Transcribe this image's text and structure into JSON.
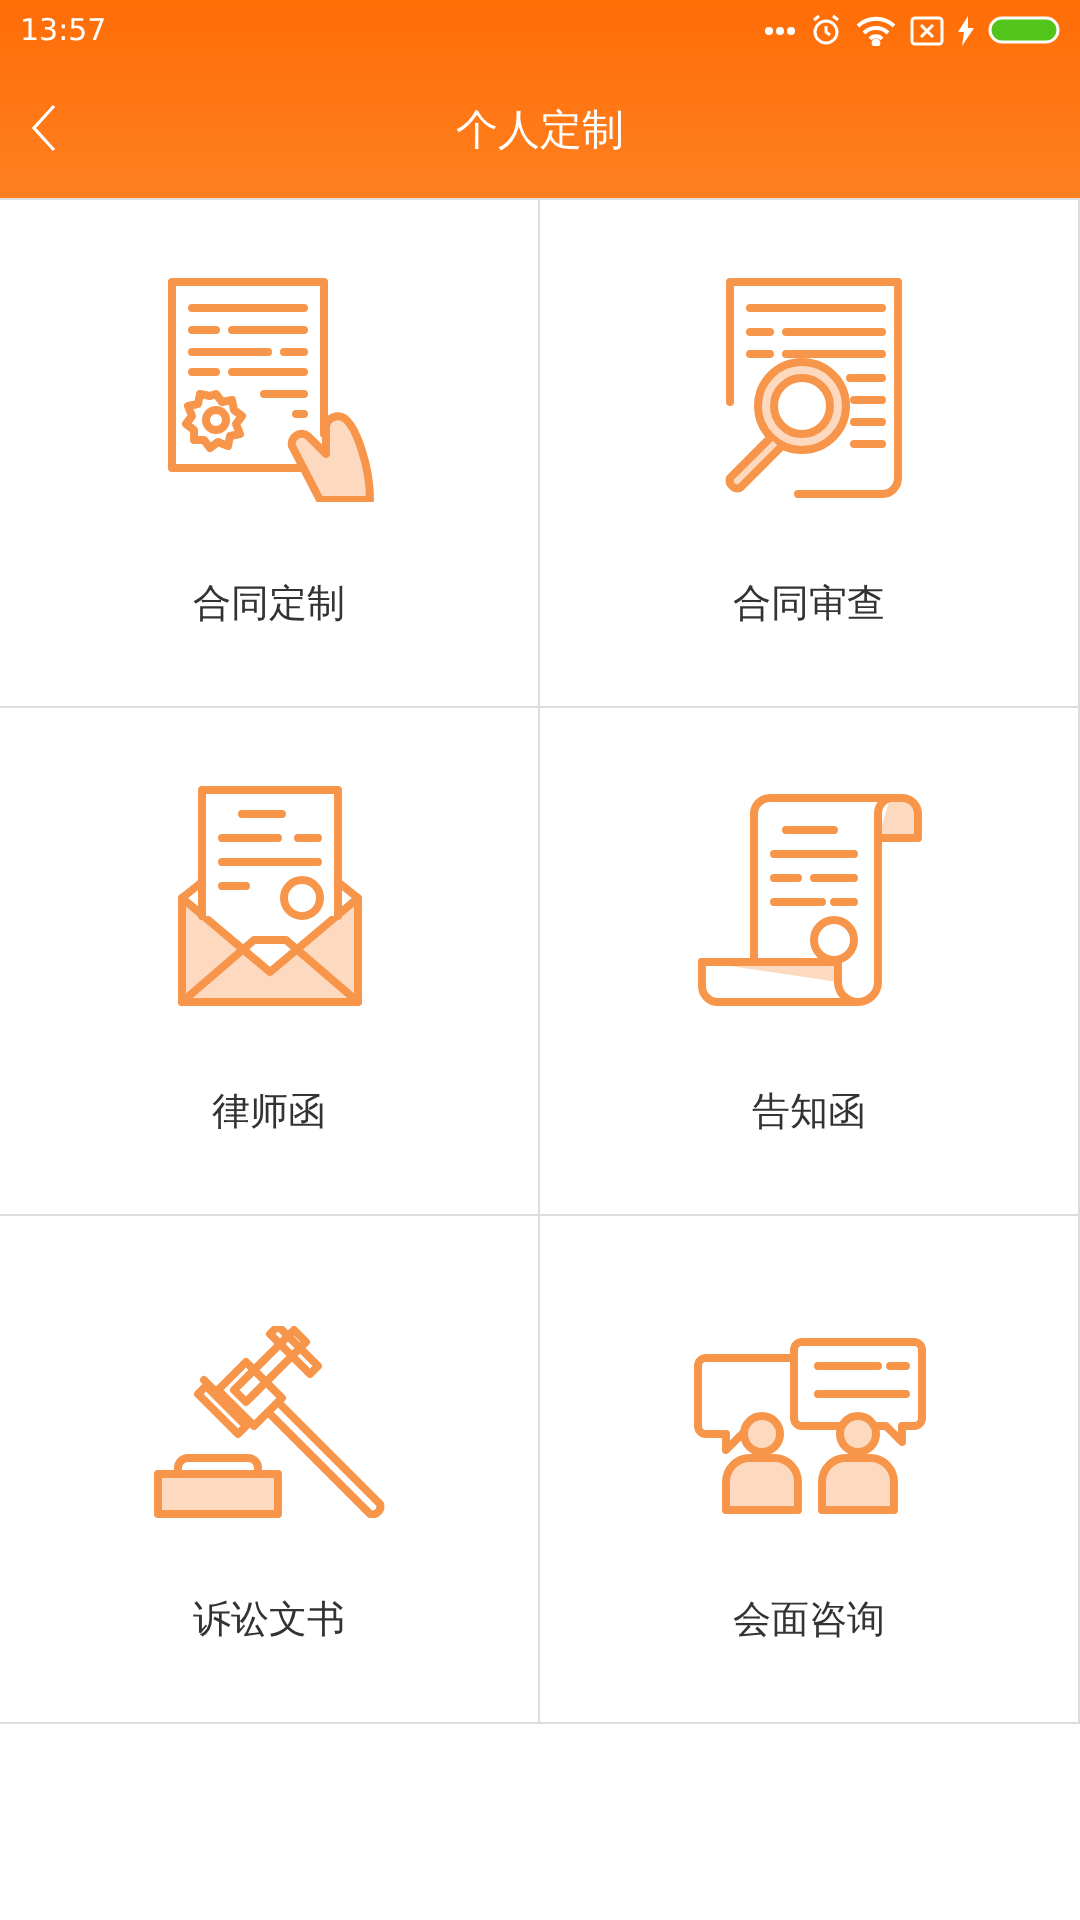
{
  "status_bar": {
    "time": "13:57"
  },
  "toolbar": {
    "title": "个人定制"
  },
  "services": [
    {
      "label": "合同定制",
      "kind": "contract"
    },
    {
      "label": "合同审查",
      "kind": "review"
    },
    {
      "label": "律师函",
      "kind": "letter"
    },
    {
      "label": "告知函",
      "kind": "notice"
    },
    {
      "label": "诉讼文书",
      "kind": "litigation"
    },
    {
      "label": "会面咨询",
      "kind": "meeting"
    }
  ]
}
